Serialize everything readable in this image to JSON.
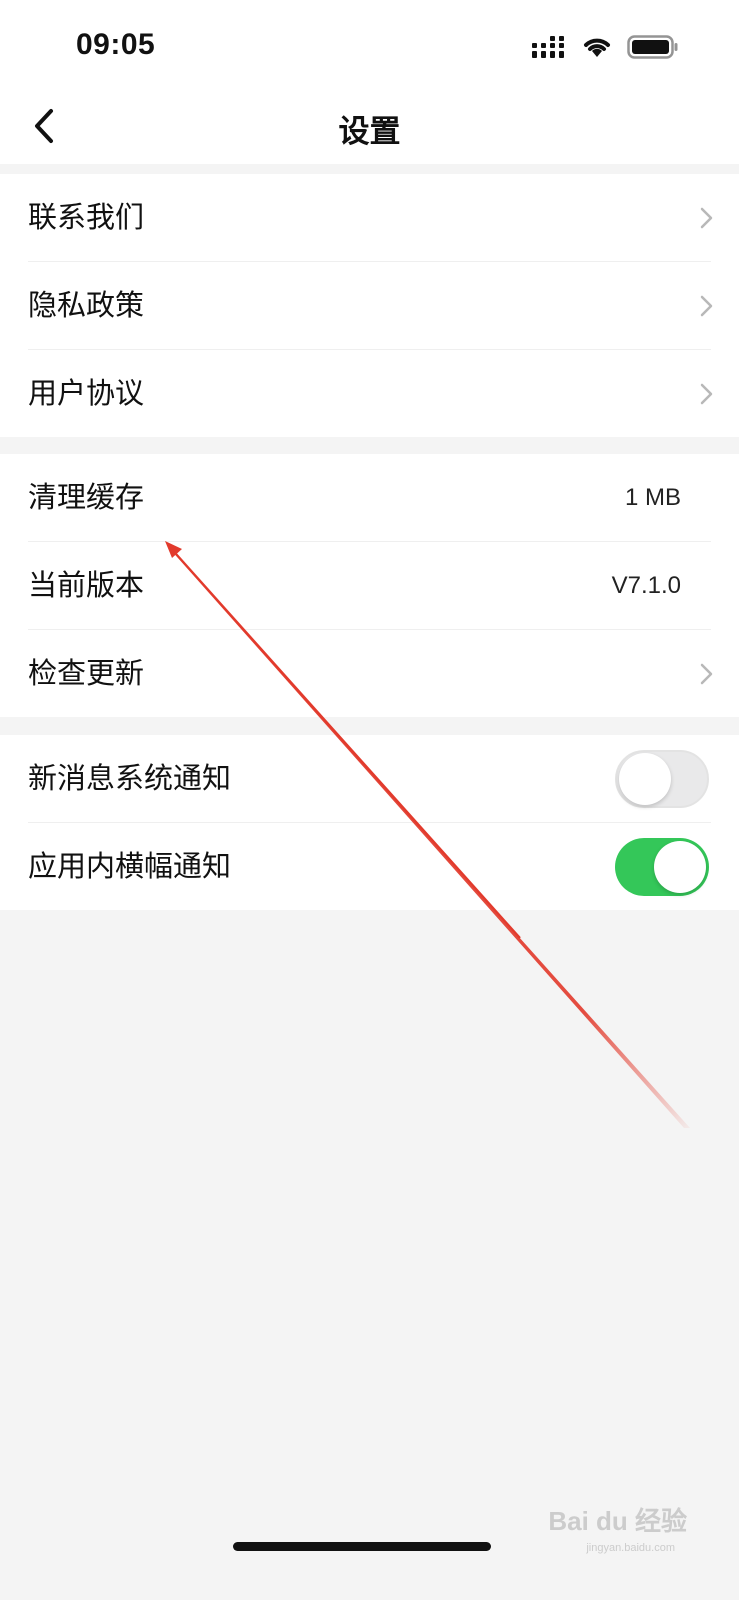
{
  "status_bar": {
    "time": "09:05",
    "icons": [
      "signal-icon",
      "wifi-icon",
      "battery-icon"
    ]
  },
  "nav": {
    "title": "设置",
    "back_icon": "chevron-left-icon"
  },
  "groups": [
    {
      "rows": [
        {
          "label": "联系我们",
          "accessory": "chevron"
        },
        {
          "label": "隐私政策",
          "accessory": "chevron"
        },
        {
          "label": "用户协议",
          "accessory": "chevron"
        }
      ]
    },
    {
      "rows": [
        {
          "label": "清理缓存",
          "value": "1 MB"
        },
        {
          "label": "当前版本",
          "value": "V7.1.0"
        },
        {
          "label": "检查更新",
          "accessory": "chevron"
        }
      ]
    },
    {
      "rows": [
        {
          "label": "新消息系统通知",
          "toggle": false
        },
        {
          "label": "应用内横幅通知",
          "toggle": true
        }
      ]
    }
  ],
  "watermark": {
    "text": "Bai du 经验",
    "sub": "jingyan.baidu.com"
  },
  "colors": {
    "toggle_on": "#34c759",
    "toggle_off": "#e9e9ea",
    "annotation_arrow": "#e23a2c",
    "background": "#f4f4f4"
  }
}
